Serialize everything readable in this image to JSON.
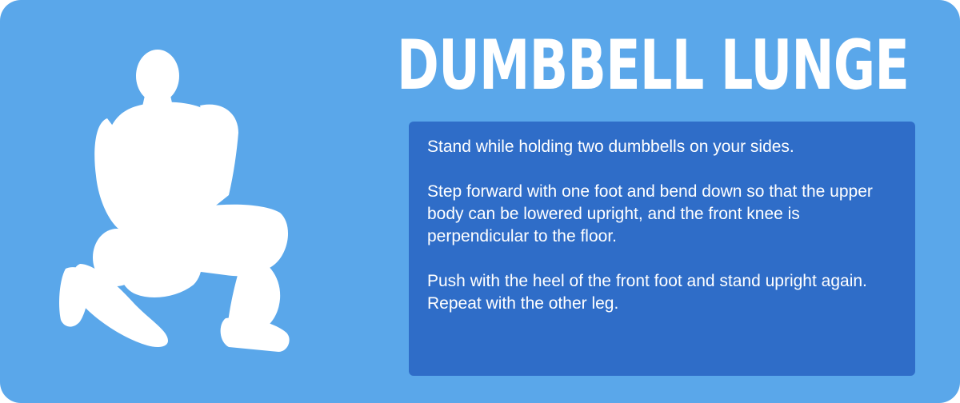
{
  "card": {
    "background_color": "#5aa7ea",
    "panel_color": "#2f6dc8",
    "text_color": "#ffffff"
  },
  "illustration": {
    "icon": "kneeling-lunge-silhouette-icon"
  },
  "title": "DUMBBELL LUNGE",
  "instructions": [
    "Stand while holding two dumbbells on your sides.",
    "Step forward with one foot and bend down so that the upper body can be lowered upright, and the front knee is perpendicular to the floor.",
    "Push with the heel of the front foot and stand upright again. Repeat with the other leg."
  ]
}
